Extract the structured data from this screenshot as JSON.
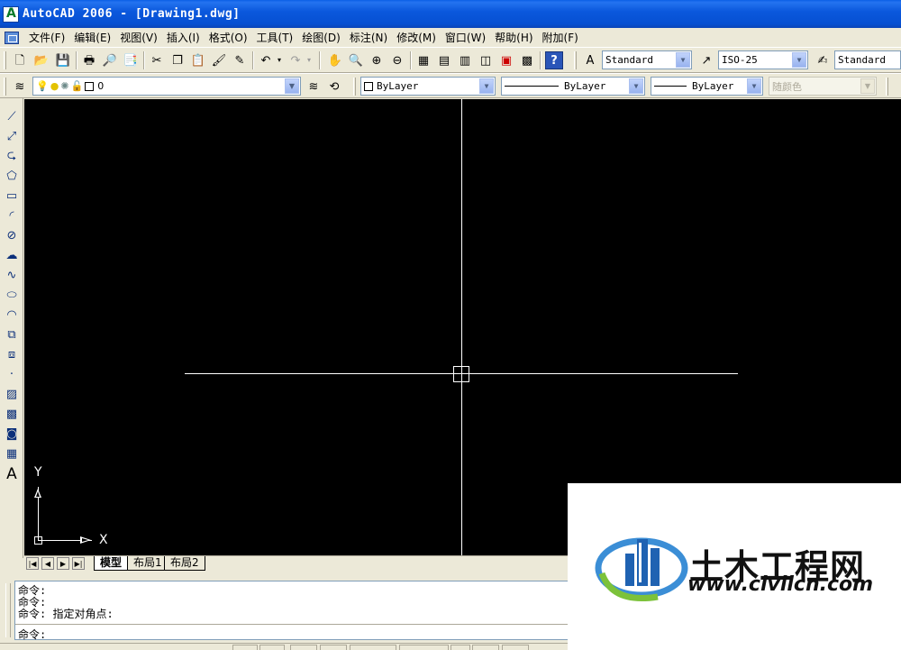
{
  "window": {
    "title": "AutoCAD 2006 - [Drawing1.dwg]"
  },
  "menu": {
    "items": [
      "文件(F)",
      "编辑(E)",
      "视图(V)",
      "插入(I)",
      "格式(O)",
      "工具(T)",
      "绘图(D)",
      "标注(N)",
      "修改(M)",
      "窗口(W)",
      "帮助(H)",
      "附加(F)"
    ]
  },
  "standard_toolbar": {
    "icons": [
      "new-icon",
      "open-icon",
      "save-icon",
      "plot-icon",
      "plot-preview-icon",
      "publish-icon",
      "cut-icon",
      "copy-icon",
      "paste-icon",
      "match-properties-icon",
      "block-editor-icon",
      "undo-icon",
      "redo-icon",
      "pan-icon",
      "zoom-realtime-icon",
      "zoom-window-icon",
      "zoom-previous-icon",
      "properties-icon",
      "design-center-icon",
      "tool-palettes-icon",
      "sheet-set-icon",
      "markup-icon",
      "calculator-icon",
      "help-icon"
    ]
  },
  "styles_toolbar": {
    "text_style": "Standard",
    "dim_style": "ISO-25",
    "table_style": "Standard"
  },
  "layers_toolbar": {
    "current_layer": "0"
  },
  "properties_toolbar": {
    "color": "ByLayer",
    "linetype": "ByLayer",
    "lineweight": "ByLayer",
    "plot_style": "随颜色"
  },
  "draw_toolbar": {
    "icons": [
      "line-icon",
      "construction-line-icon",
      "polyline-icon",
      "polygon-icon",
      "rectangle-icon",
      "arc-icon",
      "circle-icon",
      "revision-cloud-icon",
      "spline-icon",
      "ellipse-icon",
      "ellipse-arc-icon",
      "insert-block-icon",
      "make-block-icon",
      "point-icon",
      "hatch-icon",
      "gradient-icon",
      "region-icon",
      "table-icon",
      "multiline-text-icon"
    ]
  },
  "canvas": {
    "background": "#000000",
    "ucs": {
      "x_label": "X",
      "y_label": "Y"
    }
  },
  "layout_tabs": [
    "模型",
    "布局1",
    "布局2"
  ],
  "command_line": {
    "history": [
      "命令:",
      "命令:",
      "命令: 指定对角点:"
    ],
    "prompt": "命令:"
  },
  "watermark": {
    "brand_cn": "土木工程网",
    "url": "www.civilcn.com"
  }
}
